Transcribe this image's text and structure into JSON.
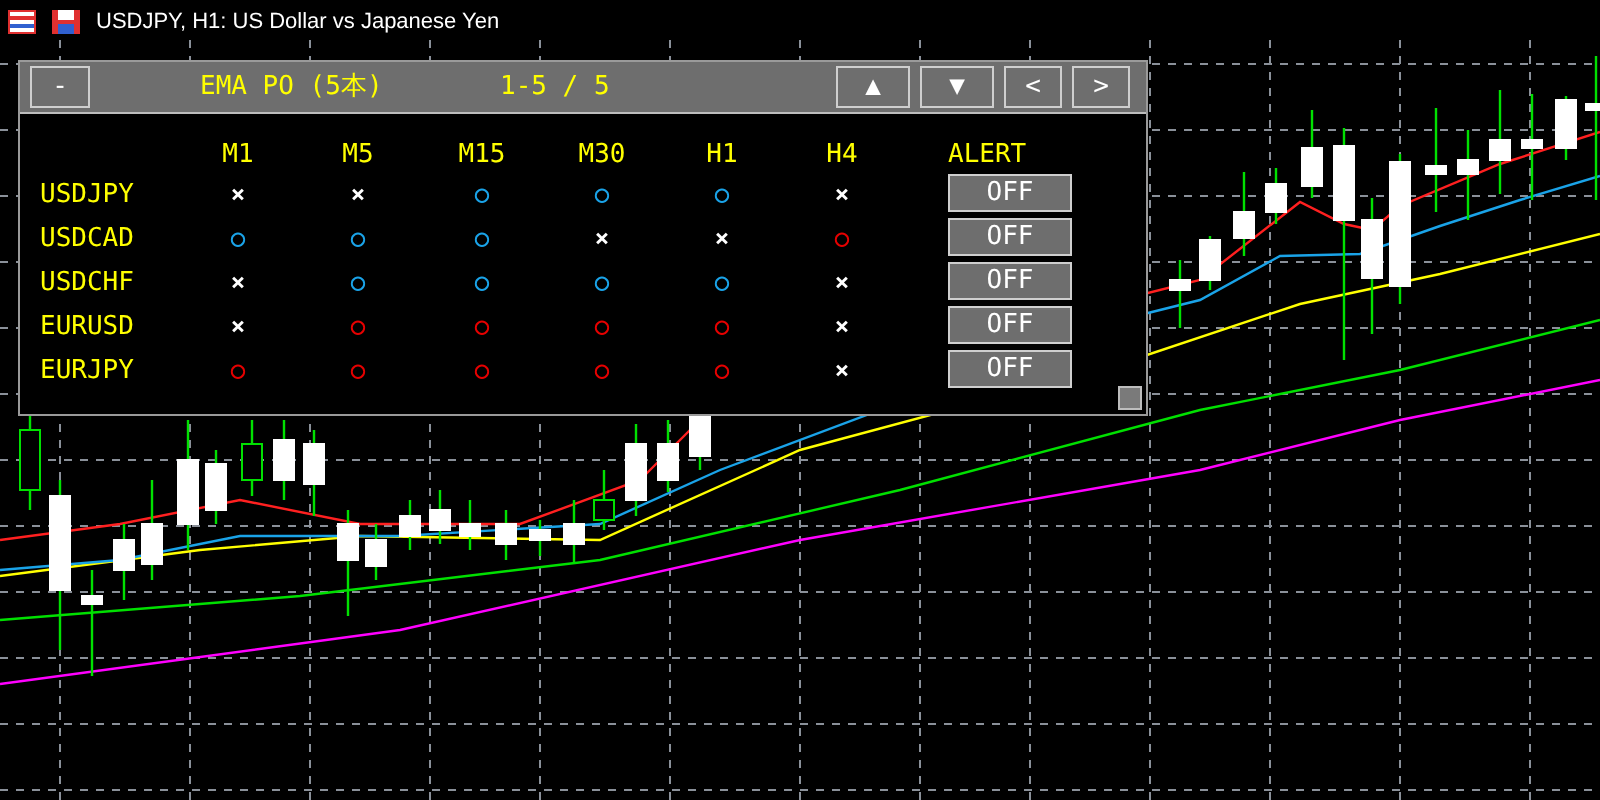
{
  "window": {
    "title": "USDJPY, H1:  US Dollar vs Japanese Yen"
  },
  "panel": {
    "minimize": "-",
    "title": "EMA PO (5本)",
    "page": "1-5 / 5",
    "nav": [
      "▲",
      "▼",
      "<",
      ">"
    ],
    "columns": [
      "M1",
      "M5",
      "M15",
      "M30",
      "H1",
      "H4",
      "ALERT"
    ],
    "rows": [
      {
        "pair": "USDJPY",
        "cells": [
          {
            "symbol": "×",
            "color": "#ffffff"
          },
          {
            "symbol": "×",
            "color": "#ffffff"
          },
          {
            "symbol": "○",
            "color": "#1aa3e8"
          },
          {
            "symbol": "○",
            "color": "#1aa3e8"
          },
          {
            "symbol": "○",
            "color": "#1aa3e8"
          },
          {
            "symbol": "×",
            "color": "#ffffff"
          }
        ],
        "alert": "OFF"
      },
      {
        "pair": "USDCAD",
        "cells": [
          {
            "symbol": "○",
            "color": "#1aa3e8"
          },
          {
            "symbol": "○",
            "color": "#1aa3e8"
          },
          {
            "symbol": "○",
            "color": "#1aa3e8"
          },
          {
            "symbol": "×",
            "color": "#ffffff"
          },
          {
            "symbol": "×",
            "color": "#ffffff"
          },
          {
            "symbol": "○",
            "color": "#e60000"
          }
        ],
        "alert": "OFF"
      },
      {
        "pair": "USDCHF",
        "cells": [
          {
            "symbol": "×",
            "color": "#ffffff"
          },
          {
            "symbol": "○",
            "color": "#1aa3e8"
          },
          {
            "symbol": "○",
            "color": "#1aa3e8"
          },
          {
            "symbol": "○",
            "color": "#1aa3e8"
          },
          {
            "symbol": "○",
            "color": "#1aa3e8"
          },
          {
            "symbol": "×",
            "color": "#ffffff"
          }
        ],
        "alert": "OFF"
      },
      {
        "pair": "EURUSD",
        "cells": [
          {
            "symbol": "×",
            "color": "#ffffff"
          },
          {
            "symbol": "○",
            "color": "#e60000"
          },
          {
            "symbol": "○",
            "color": "#e60000"
          },
          {
            "symbol": "○",
            "color": "#e60000"
          },
          {
            "symbol": "○",
            "color": "#e60000"
          },
          {
            "symbol": "×",
            "color": "#ffffff"
          }
        ],
        "alert": "OFF"
      },
      {
        "pair": "EURJPY",
        "cells": [
          {
            "symbol": "○",
            "color": "#e60000"
          },
          {
            "symbol": "○",
            "color": "#e60000"
          },
          {
            "symbol": "○",
            "color": "#e60000"
          },
          {
            "symbol": "○",
            "color": "#e60000"
          },
          {
            "symbol": "○",
            "color": "#e60000"
          },
          {
            "symbol": "×",
            "color": "#ffffff"
          }
        ],
        "alert": "OFF"
      }
    ]
  }
}
